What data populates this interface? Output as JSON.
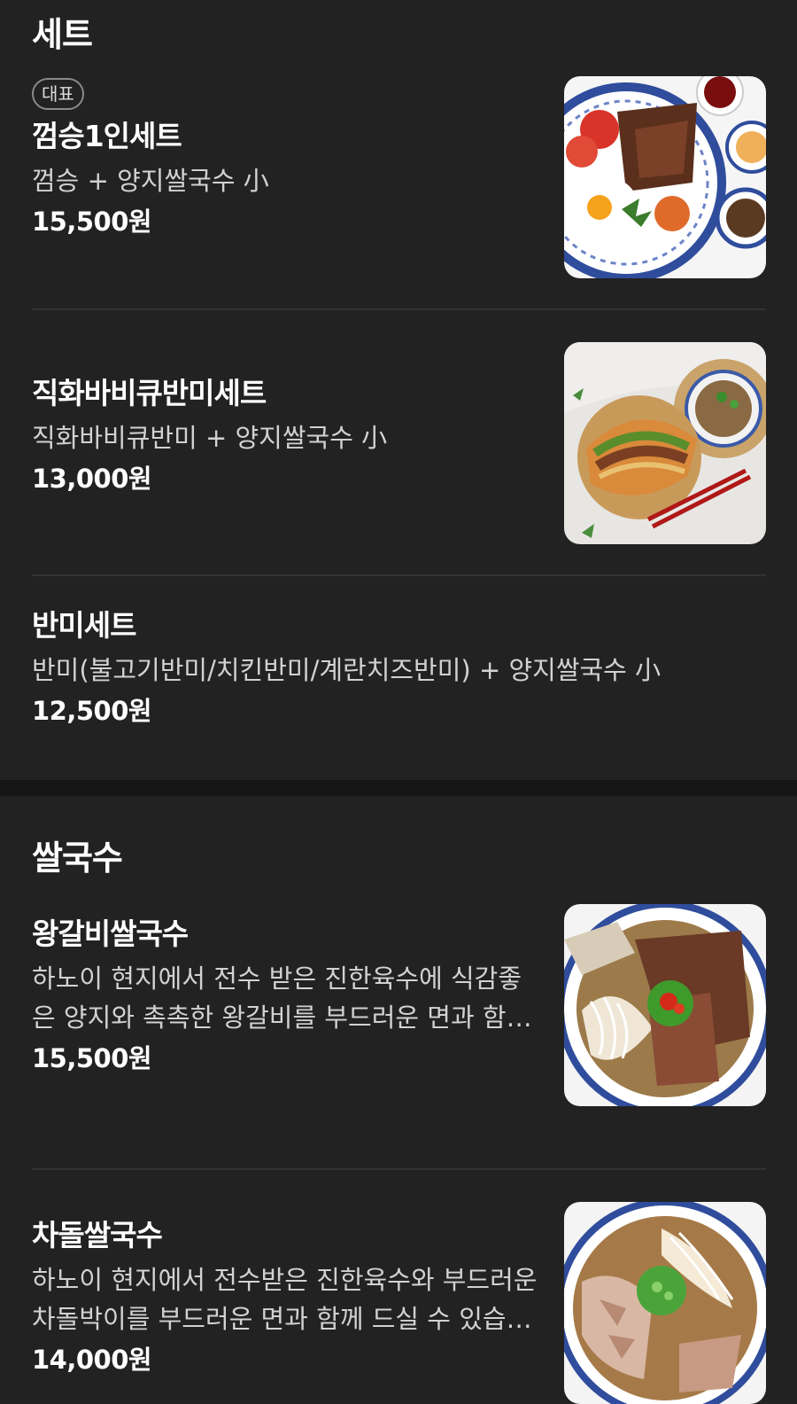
{
  "sections": [
    {
      "title": "세트",
      "items": [
        {
          "badge": "대표",
          "name": "껌승1인세트",
          "desc": "껌승 + 양지쌀국수 小",
          "price": "15,500원",
          "image": "com-tam-set-photo"
        },
        {
          "name": "직화바비큐반미세트",
          "desc": "직화바비큐반미 + 양지쌀국수 小",
          "price": "13,000원",
          "image": "banh-mi-set-photo"
        },
        {
          "name": "반미세트",
          "desc": "반미(불고기반미/치킨반미/계란치즈반미) + 양지쌀국수 小",
          "price": "12,500원"
        }
      ]
    },
    {
      "title": "쌀국수",
      "items": [
        {
          "name": "왕갈비쌀국수",
          "desc": "하노이 현지에서 전수 받은 진한육수에 식감좋은 양지와 촉촉한 왕갈비를 부드러운 면과 함께 드실 수 있습니다.",
          "price": "15,500원",
          "image": "galbi-pho-photo"
        },
        {
          "name": "차돌쌀국수",
          "desc": "하노이 현지에서 전수받은 진한육수와 부드러운 차돌박이를 부드러운 면과 함께 드실 수 있습니다.",
          "price": "14,000원",
          "image": "brisket-pho-photo"
        }
      ]
    }
  ]
}
